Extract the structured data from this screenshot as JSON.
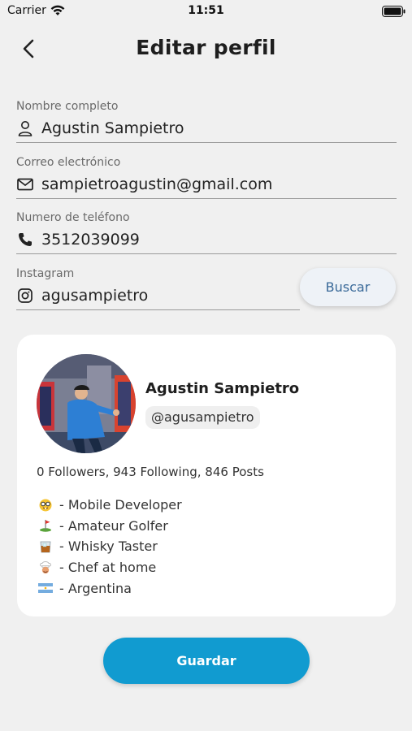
{
  "status_bar": {
    "carrier": "Carrier",
    "time": "11:51"
  },
  "header": {
    "title": "Editar perfil",
    "back_icon": "chevron-left-icon"
  },
  "form": {
    "name": {
      "label": "Nombre completo",
      "value": "Agustin Sampietro",
      "icon": "person-icon"
    },
    "email": {
      "label": "Correo electrónico",
      "value": "sampietroagustin@gmail.com",
      "icon": "mail-icon"
    },
    "phone": {
      "label": "Numero de teléfono",
      "value": "3512039099",
      "icon": "phone-icon"
    },
    "instagram": {
      "label": "Instagram",
      "value": "agusampietro",
      "icon": "instagram-icon"
    },
    "search_button": "Buscar"
  },
  "profile_card": {
    "name": "Agustin Sampietro",
    "username": "@agusampietro",
    "stats": "0 Followers, 943 Following, 846 Posts",
    "bio": [
      {
        "icon": "nerd-face-emoji",
        "text": "- Mobile Developer"
      },
      {
        "icon": "golf-flag-emoji",
        "text": "- Amateur Golfer"
      },
      {
        "icon": "whisky-glass-emoji",
        "text": "- Whisky Taster"
      },
      {
        "icon": "chef-emoji",
        "text": "- Chef at home"
      },
      {
        "icon": "argentina-flag-emoji",
        "text": "- Argentina"
      }
    ]
  },
  "save_button": "Guardar",
  "colors": {
    "primary": "#119bd0",
    "background": "#f0f0f0",
    "card": "#ffffff",
    "secondary_text": "#3a6a99"
  }
}
